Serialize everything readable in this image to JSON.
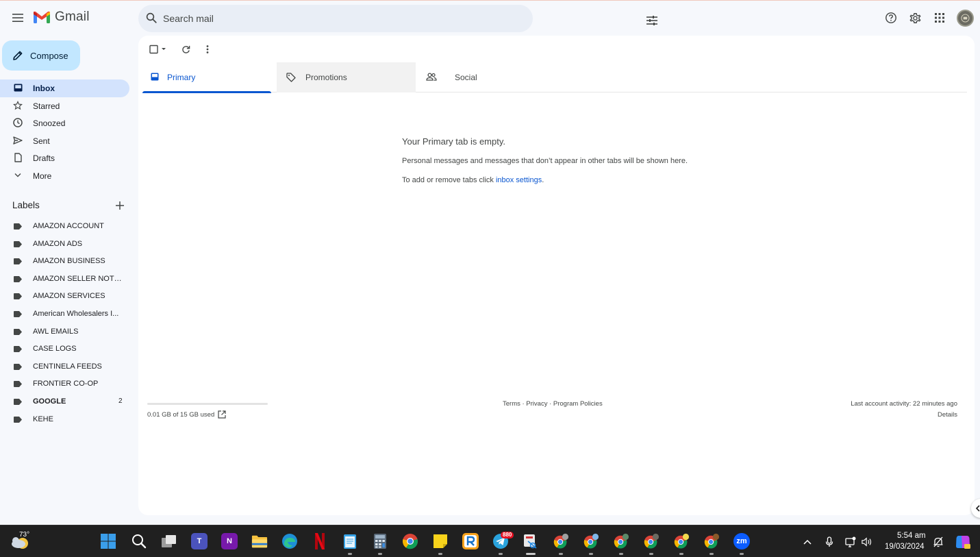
{
  "header": {
    "app_name": "Gmail",
    "search_placeholder": "Search mail"
  },
  "sidebar": {
    "compose_label": "Compose",
    "nav": [
      {
        "label": "Inbox",
        "icon": "inbox-icon",
        "active": true
      },
      {
        "label": "Starred",
        "icon": "star-icon"
      },
      {
        "label": "Snoozed",
        "icon": "clock-icon"
      },
      {
        "label": "Sent",
        "icon": "send-icon"
      },
      {
        "label": "Drafts",
        "icon": "draft-icon"
      },
      {
        "label": "More",
        "icon": "chevron-down-icon"
      }
    ],
    "labels_header": "Labels",
    "labels": [
      {
        "label": "AMAZON ACCOUNT"
      },
      {
        "label": "AMAZON ADS"
      },
      {
        "label": "AMAZON BUSINESS"
      },
      {
        "label": "AMAZON SELLER NOTIF..."
      },
      {
        "label": "AMAZON SERVICES"
      },
      {
        "label": "American Wholesalers I..."
      },
      {
        "label": "AWL EMAILS"
      },
      {
        "label": "CASE LOGS"
      },
      {
        "label": "CENTINELA FEEDS"
      },
      {
        "label": "FRONTIER CO-OP"
      },
      {
        "label": "GOOGLE",
        "count": "2",
        "bold": true
      },
      {
        "label": "KEHE"
      }
    ]
  },
  "tabs": [
    {
      "label": "Primary",
      "icon": "inbox-tab-icon",
      "active": true
    },
    {
      "label": "Promotions",
      "icon": "tag-icon"
    },
    {
      "label": "Social",
      "icon": "people-icon"
    }
  ],
  "empty_state": {
    "title": "Your Primary tab is empty.",
    "description": "Personal messages and messages that don’t appear in other tabs will be shown here.",
    "tabs_prefix": "To add or remove tabs click ",
    "tabs_link": "inbox settings",
    "tabs_suffix": "."
  },
  "footer": {
    "storage": "0.01 GB of 15 GB used",
    "storage_used_fraction": 0.0007,
    "links": "Terms · Privacy · Program Policies",
    "last_activity": "Last account activity: 22 minutes ago",
    "details": "Details"
  },
  "taskbar": {
    "weather_temp": "73°",
    "telegram_badge": "880",
    "time": "5:54 am",
    "date": "19/03/2024",
    "apps": [
      "start",
      "search",
      "task-view",
      "teams",
      "onenote",
      "file-explorer",
      "edge",
      "netflix",
      "notepad",
      "calculator",
      "chrome",
      "sticky-notes",
      "app-r",
      "telegram",
      "snipping-tool",
      "chrome-profile-1",
      "chrome-profile-2",
      "chrome-profile-3",
      "chrome-profile-4",
      "chrome-profile-5",
      "chrome-profile-6",
      "zoom"
    ]
  }
}
